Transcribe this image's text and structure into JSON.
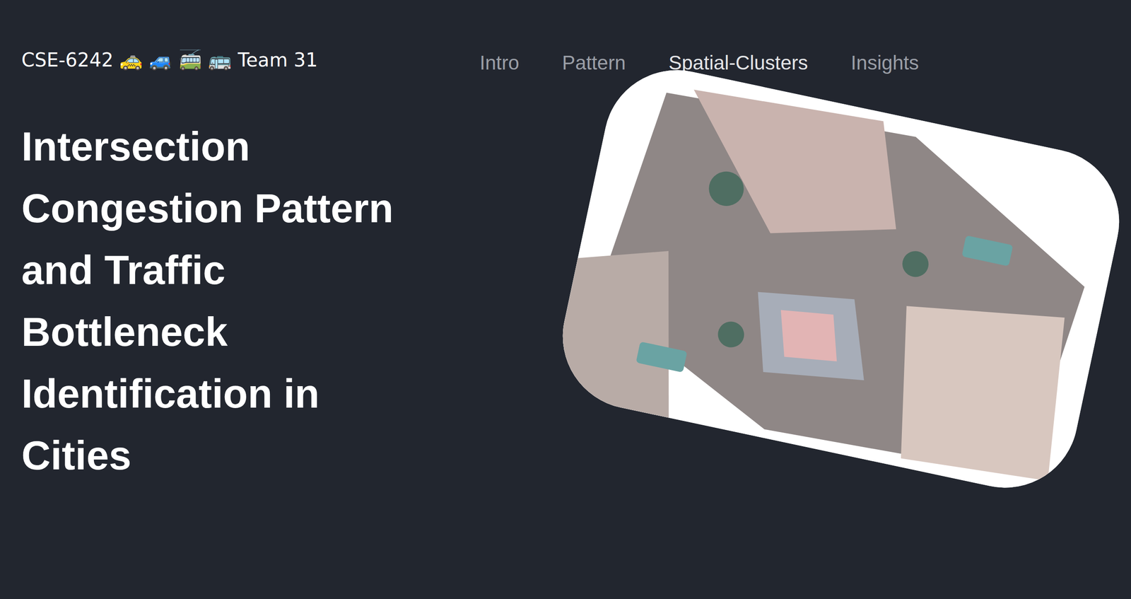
{
  "header": {
    "brand": "CSE-6242 🚕 🚙 🚎 🚌 Team 31"
  },
  "nav": [
    {
      "label": "Intro",
      "selected": false
    },
    {
      "label": "Pattern",
      "selected": false
    },
    {
      "label": "Spatial-Clusters",
      "selected": true
    },
    {
      "label": "Insights",
      "selected": false
    }
  ],
  "hero": {
    "title_lines": [
      "Intersection",
      "Congestion Pattern",
      "and Traffic",
      "Bottleneck",
      "Identification in",
      "Cities"
    ]
  }
}
